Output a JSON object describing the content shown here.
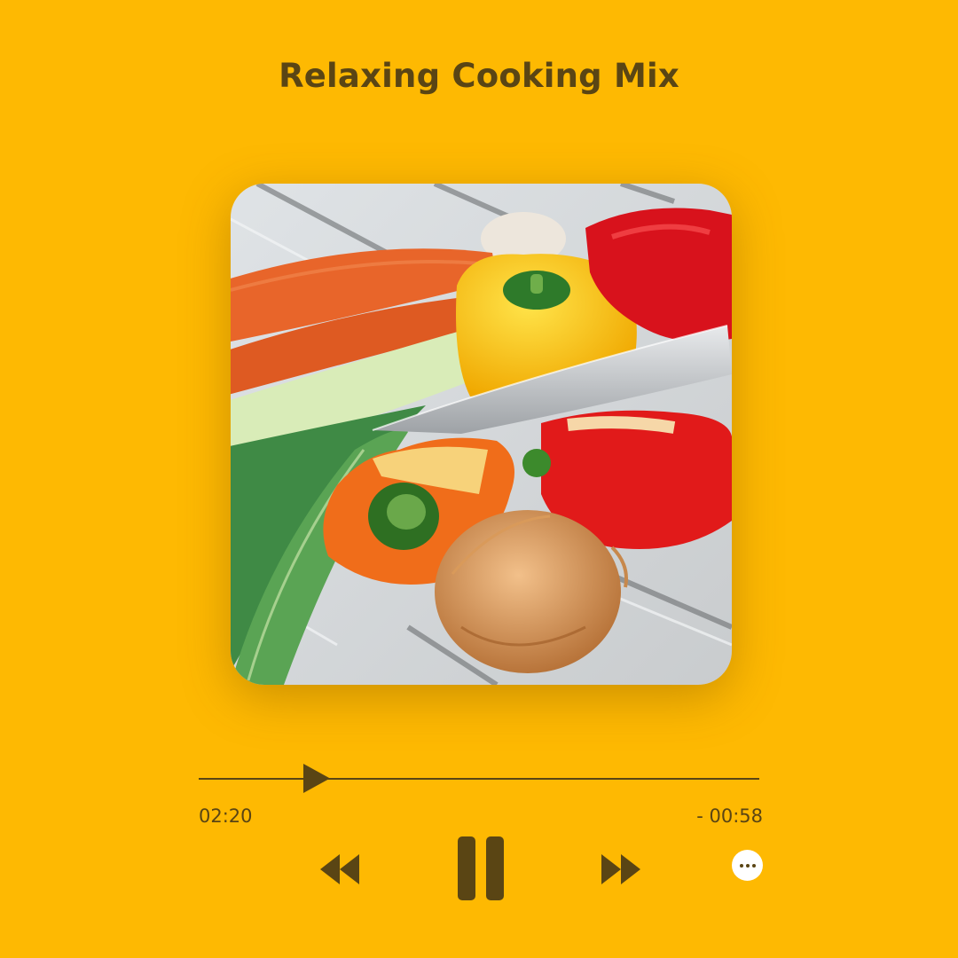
{
  "player": {
    "title": "Relaxing Cooking Mix",
    "elapsed": "02:20",
    "remaining": "- 00:58",
    "progress_fraction": 0.19,
    "state": "playing"
  },
  "artwork": {
    "description_icon": "vegetables-artwork"
  },
  "controls": {
    "rewind_icon": "rewind-icon",
    "pause_icon": "pause-icon",
    "forward_icon": "fast-forward-icon",
    "more_icon": "more-options-icon"
  },
  "colors": {
    "background": "#FEB902",
    "foreground": "#5A4514",
    "more_button": "#FFFFFF"
  }
}
